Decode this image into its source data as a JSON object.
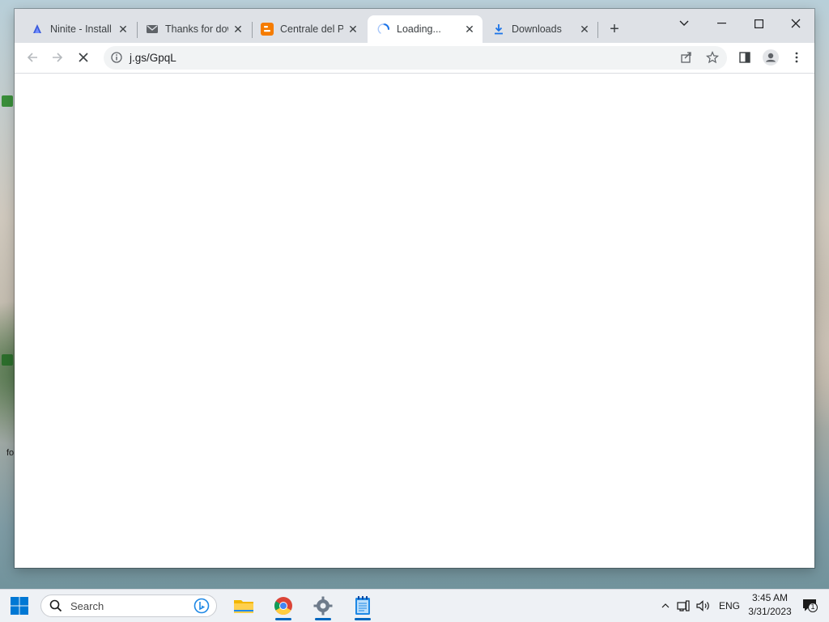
{
  "browser": {
    "tabs": [
      {
        "title": "Ninite - Install",
        "icon": "ninite-icon",
        "active": false
      },
      {
        "title": "Thanks for dow",
        "icon": "mail-icon",
        "active": false
      },
      {
        "title": "Centrale del Pr",
        "icon": "blogger-icon",
        "active": false
      },
      {
        "title": "Loading...",
        "icon": "loading-spinner-icon",
        "active": true
      },
      {
        "title": "Downloads",
        "icon": "download-icon",
        "active": false
      }
    ],
    "url": "j.gs/GpqL"
  },
  "taskbar": {
    "search_label": "Search",
    "language": "ENG",
    "time": "3:45 AM",
    "date": "3/31/2023",
    "notification_count": "1"
  },
  "colors": {
    "accent": "#0067c0",
    "tabstrip": "#dee1e6",
    "loading_spinner": "#1a73e8"
  }
}
